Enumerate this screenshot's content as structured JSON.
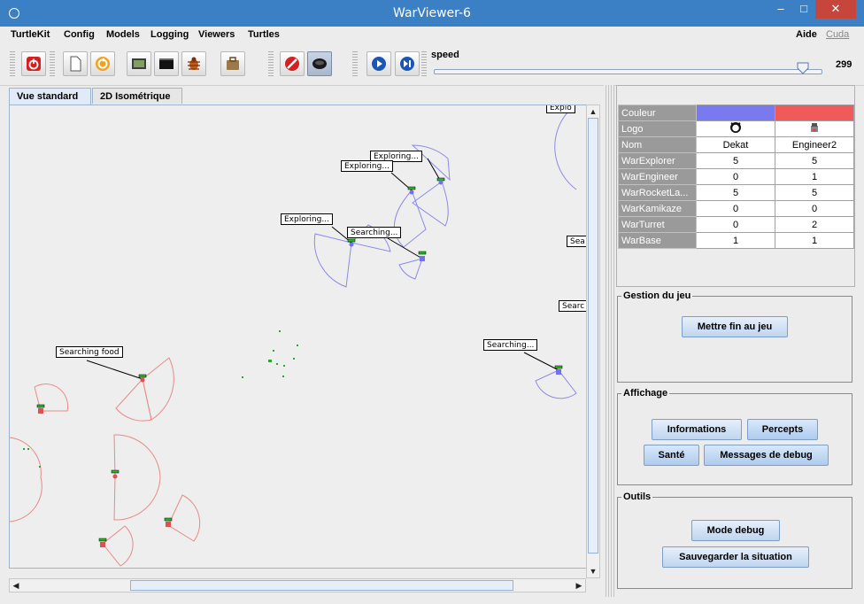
{
  "window": {
    "title": "WarViewer-6",
    "controls": {
      "minimize": "–",
      "maximize": "□",
      "close": "✕"
    }
  },
  "menubar": {
    "items": [
      "TurtleKit",
      "Config",
      "Models",
      "Logging",
      "Viewers",
      "Turtles"
    ],
    "help": "Aide",
    "cuda": "Cuda"
  },
  "toolbar": {
    "icons": [
      "power-icon",
      "new-page-icon",
      "reset-icon",
      "image-icon",
      "terminal-icon",
      "bug-icon",
      "briefcase-icon",
      "stop-icon",
      "record-icon",
      "play-icon",
      "step-icon"
    ],
    "speed": {
      "label": "speed",
      "value": "299",
      "fraction": 0.95
    }
  },
  "tabs": [
    "Vue standard",
    "2D Isométrique"
  ],
  "map": {
    "labels": [
      "Exploring...",
      "Exploring...",
      "Exploring...",
      "Searching...",
      "Searching food",
      "Searching...",
      "Sea",
      "Searc",
      "Explo"
    ],
    "colors": {
      "blue_team": "#7070f0",
      "red_team": "#e05050",
      "resource": "#2aa82a",
      "health": "#22bb22"
    }
  },
  "team_table": {
    "rows": [
      {
        "key": "Couleur",
        "a": "",
        "b": ""
      },
      {
        "key": "Logo",
        "a": "",
        "b": ""
      },
      {
        "key": "Nom",
        "a": "Dekat",
        "b": "Engineer2"
      },
      {
        "key": "WarExplorer",
        "a": "5",
        "b": "5"
      },
      {
        "key": "WarEngineer",
        "a": "0",
        "b": "1"
      },
      {
        "key": "WarRocketLa...",
        "a": "5",
        "b": "5"
      },
      {
        "key": "WarKamikaze",
        "a": "0",
        "b": "0"
      },
      {
        "key": "WarTurret",
        "a": "0",
        "b": "2"
      },
      {
        "key": "WarBase",
        "a": "1",
        "b": "1"
      }
    ],
    "team_colors": [
      "#7a7af0",
      "#f05a5a"
    ]
  },
  "gestion": {
    "title": "Gestion du jeu",
    "end_game": "Mettre fin au jeu"
  },
  "affichage": {
    "title": "Affichage",
    "informations": "Informations",
    "percepts": "Percepts",
    "sante": "Santé",
    "debug_messages": "Messages de debug"
  },
  "outils": {
    "title": "Outils",
    "debug_mode": "Mode debug",
    "save": "Sauvegarder la situation"
  }
}
